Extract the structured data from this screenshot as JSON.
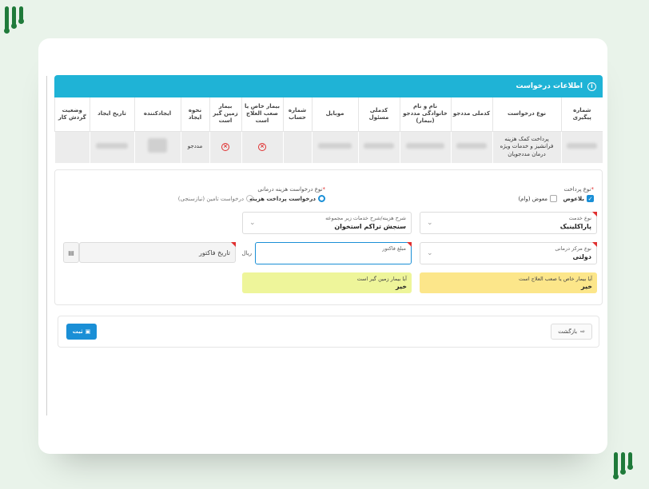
{
  "panel": {
    "title": "اطلاعات درخواست",
    "info_icon": "info-icon"
  },
  "table": {
    "headers": [
      "شماره پیگیری",
      "نوع درخواست",
      "کدملی مددجو",
      "نام و نام خانوادگی مددجو (بیمار)",
      "کدملی مسئول",
      "موبایل",
      "شماره حساب",
      "بیمار خاص یا صعب العلاج است",
      "بیمار زمین گیر است",
      "نحوه ایجاد",
      "ایجادکننده",
      "تاریخ ایجاد",
      "وضعیت گردش کار"
    ],
    "row": {
      "request_type": "پرداخت کمک هزینه فرانشیز و خدمات ویژه درمان مددجویان",
      "creation_method": "مددجو"
    }
  },
  "form": {
    "payment_type_label": "نوع پرداخت",
    "payment_options": [
      {
        "label": "بلاعوض",
        "checked": true
      },
      {
        "label": "معوض (وام)",
        "checked": false
      }
    ],
    "medical_request_type_label": "نوع درخواست هزینه درمانی",
    "medical_request_options": [
      {
        "label": "درخواست پرداخت هزینه",
        "selected": true
      },
      {
        "label": "درخواست تامین (نیازسنجی)",
        "selected": false
      }
    ],
    "service_type": {
      "label": "نوع خدمت",
      "value": "پاراکلینیک"
    },
    "cost_description": {
      "label": "شرح هزینه/شرح خدمات زیر مجموعه",
      "value": "سنجش تراکم استخوان"
    },
    "center_type": {
      "label": "نوع مرکز درمانی",
      "value": "دولتی"
    },
    "invoice_amount": {
      "label": "مبلغ فاکتور",
      "value": "",
      "unit": "ریال"
    },
    "invoice_date": {
      "placeholder": "تاریخ فاکتور"
    },
    "special_patient": {
      "label": "آیا بیمار خاص یا صعب العلاج است",
      "value": "خیر",
      "color": "#fce68a"
    },
    "bedridden": {
      "label": "آیا بیمار زمین گیر است",
      "value": "خیر",
      "color": "#eef59a"
    }
  },
  "actions": {
    "back_label": "بازگشت",
    "save_label": "ثبت"
  }
}
